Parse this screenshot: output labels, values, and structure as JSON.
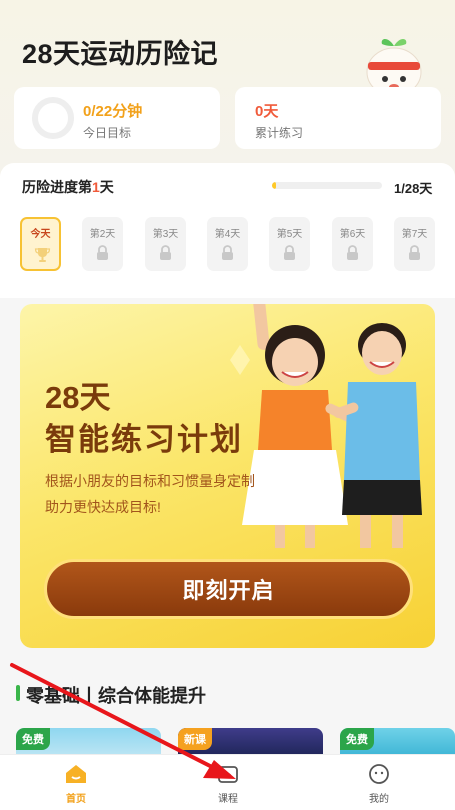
{
  "header": {
    "title": "28天运动历险记"
  },
  "stats": {
    "daily_goal_value": "0/22分钟",
    "daily_goal_label": "今日目标",
    "daily_goal_progress": 0,
    "total_days_value": "0天",
    "total_days_label": "累计练习"
  },
  "adventure": {
    "title_prefix": "历险进度第",
    "title_day": "1",
    "title_suffix": "天",
    "progress": 0.04,
    "count": "1/28天",
    "days": [
      {
        "label": "今天",
        "icon": "trophy-icon",
        "locked": false
      },
      {
        "label": "第2天",
        "icon": "lock-icon",
        "locked": true
      },
      {
        "label": "第3天",
        "icon": "lock-icon",
        "locked": true
      },
      {
        "label": "第4天",
        "icon": "lock-icon",
        "locked": true
      },
      {
        "label": "第5天",
        "icon": "lock-icon",
        "locked": true
      },
      {
        "label": "第6天",
        "icon": "lock-icon",
        "locked": true
      },
      {
        "label": "第7天",
        "icon": "lock-icon",
        "locked": true
      }
    ]
  },
  "banner": {
    "title_line1": "28天",
    "title_line2": "智能练习计划",
    "desc_line1": "根据小朋友的目标和习惯量身定制",
    "desc_line2": "助力更快达成目标!",
    "cta_label": "即刻开启"
  },
  "section": {
    "title": "零基础丨综合体能提升"
  },
  "courses": [
    {
      "tag": "免费",
      "tag_color": "#2ca54a"
    },
    {
      "tag": "新课",
      "tag_color": "#f5a11f"
    },
    {
      "tag": "免费",
      "tag_color": "#2ca54a"
    }
  ],
  "bottom_nav": {
    "items": [
      {
        "label": "首页",
        "icon": "home-icon",
        "active": true
      },
      {
        "label": "课程",
        "icon": "course-icon",
        "active": false
      },
      {
        "label": "我的",
        "icon": "profile-icon",
        "active": false
      }
    ]
  },
  "colors": {
    "accent": "#f2a11a",
    "brand_brown": "#7a3b0b",
    "highlight_red": "#f05a3a",
    "annotation_arrow": "#e8161b"
  }
}
